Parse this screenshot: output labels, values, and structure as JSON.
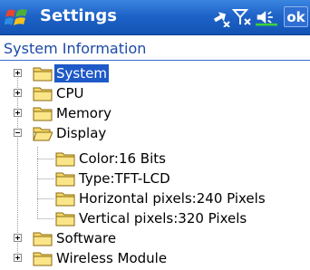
{
  "window": {
    "title": "Settings",
    "ok_label": "ok"
  },
  "tray": {
    "connectivity_icon": "connectivity-icon",
    "signal_icon": "signal-off-icon",
    "volume_icon": "speaker-icon"
  },
  "section": {
    "title": "System Information"
  },
  "tree": {
    "items": [
      {
        "label": "System",
        "state": "collapsed",
        "selected": true
      },
      {
        "label": "CPU",
        "state": "collapsed",
        "selected": false
      },
      {
        "label": "Memory",
        "state": "collapsed",
        "selected": false
      },
      {
        "label": "Display",
        "state": "expanded",
        "selected": false,
        "children": [
          {
            "label": "Color:16 Bits"
          },
          {
            "label": "Type:TFT-LCD"
          },
          {
            "label": "Horizontal pixels:240 Pixels"
          },
          {
            "label": "Vertical pixels:320 Pixels"
          }
        ]
      },
      {
        "label": "Software",
        "state": "collapsed",
        "selected": false
      },
      {
        "label": "Wireless Module",
        "state": "collapsed",
        "selected": false
      }
    ]
  },
  "colors": {
    "titlebar": "#1f63c8",
    "selection": "#1e59c8",
    "folder": "#f5d86a",
    "heading": "#1b4aa8"
  }
}
